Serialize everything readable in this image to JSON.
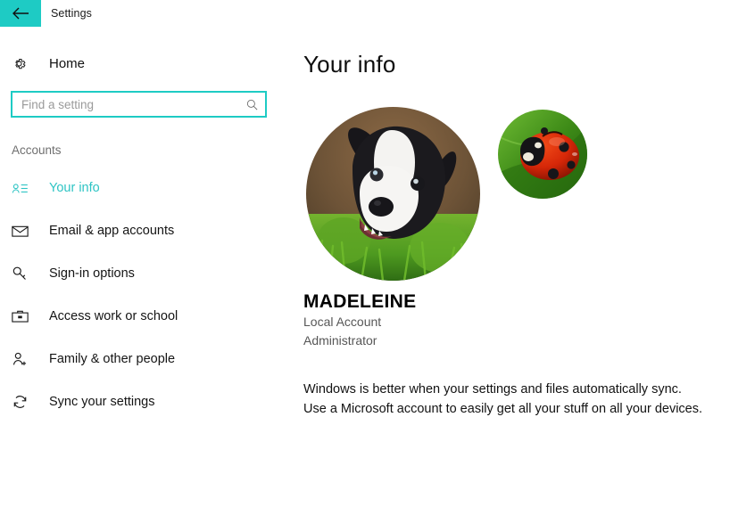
{
  "titlebar": {
    "back_icon": "back-arrow-icon",
    "title": "Settings"
  },
  "sidebar": {
    "home": {
      "icon": "gear-icon",
      "label": "Home"
    },
    "search": {
      "placeholder": "Find a setting",
      "value": "",
      "icon": "search-icon"
    },
    "section_label": "Accounts",
    "items": [
      {
        "icon": "contact-card-icon",
        "label": "Your info",
        "selected": true
      },
      {
        "icon": "envelope-icon",
        "label": "Email & app accounts",
        "selected": false
      },
      {
        "icon": "key-icon",
        "label": "Sign-in options",
        "selected": false
      },
      {
        "icon": "briefcase-icon",
        "label": "Access work or school",
        "selected": false
      },
      {
        "icon": "person-add-icon",
        "label": "Family & other people",
        "selected": false
      },
      {
        "icon": "sync-icon",
        "label": "Sync your settings",
        "selected": false
      }
    ]
  },
  "main": {
    "page_title": "Your info",
    "avatar": {
      "name": "account-picture-puppy",
      "description": "Black and white border collie puppy in green grass"
    },
    "avatar_thumbnail": {
      "name": "recent-picture-ladybug",
      "description": "Red ladybug with black spots on a green leaf"
    },
    "account_name": "MADELEINE",
    "account_type": "Local Account",
    "account_role": "Administrator",
    "sync_note": "Windows is better when your settings and files automatically sync. Use a Microsoft account to easily get all your stuff on all your devices."
  },
  "colors": {
    "accent": "#1ecbc4",
    "accent_text": "#2ec4c4",
    "text": "#141414",
    "muted": "#6f6f6f",
    "background": "#ffffff"
  }
}
